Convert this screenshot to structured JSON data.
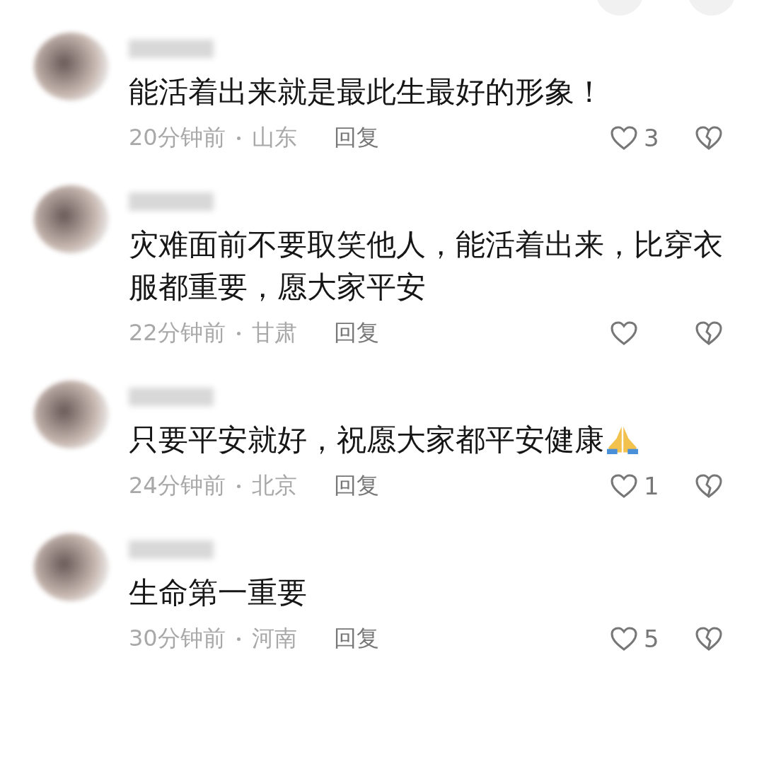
{
  "comments": [
    {
      "text": "能活着出来就是最此生最好的形象！",
      "time": "20分钟前",
      "location": "山东",
      "reply": "回复",
      "likes": "3",
      "emoji": false
    },
    {
      "text": "灾难面前不要取笑他人，能活着出来，比穿衣服都重要，愿大家平安",
      "time": "22分钟前",
      "location": "甘肃",
      "reply": "回复",
      "emoji": false
    },
    {
      "text": "只要平安就好，祝愿大家都平安健康",
      "time": "24分钟前",
      "location": "北京",
      "reply": "回复",
      "likes": "1",
      "emoji": true
    },
    {
      "text": "生命第一重要",
      "time": "30分钟前",
      "location": "河南",
      "reply": "回复",
      "likes": "5",
      "emoji": false
    }
  ]
}
